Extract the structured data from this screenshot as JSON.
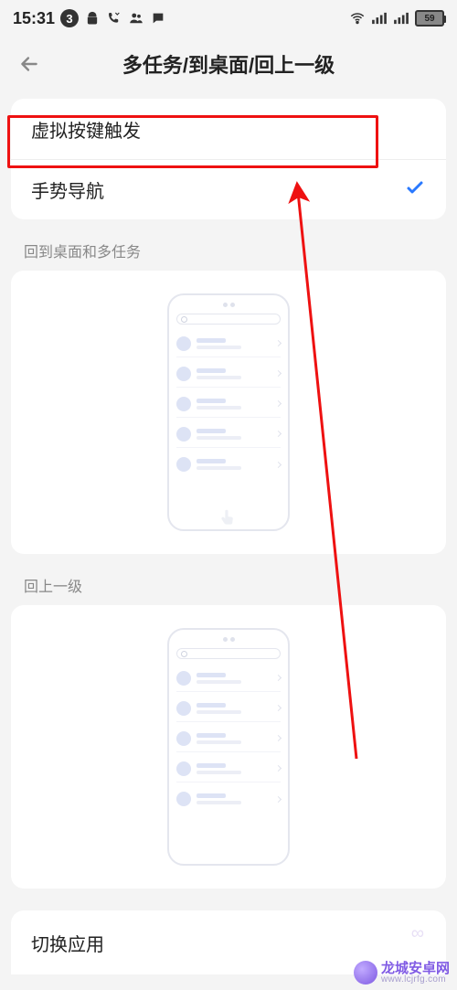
{
  "statusbar": {
    "time": "15:31",
    "notif_count": "3",
    "battery_text": "59"
  },
  "header": {
    "title": "多任务/到桌面/回上一级"
  },
  "options": {
    "virtual_keys": "虚拟按键触发",
    "gesture_nav": "手势导航"
  },
  "sections": {
    "home_multitask": "回到桌面和多任务",
    "back_level": "回上一级",
    "switch_app": "切换应用"
  },
  "watermark": {
    "title": "龙城安卓网",
    "url": "www.lcjrfg.com"
  }
}
